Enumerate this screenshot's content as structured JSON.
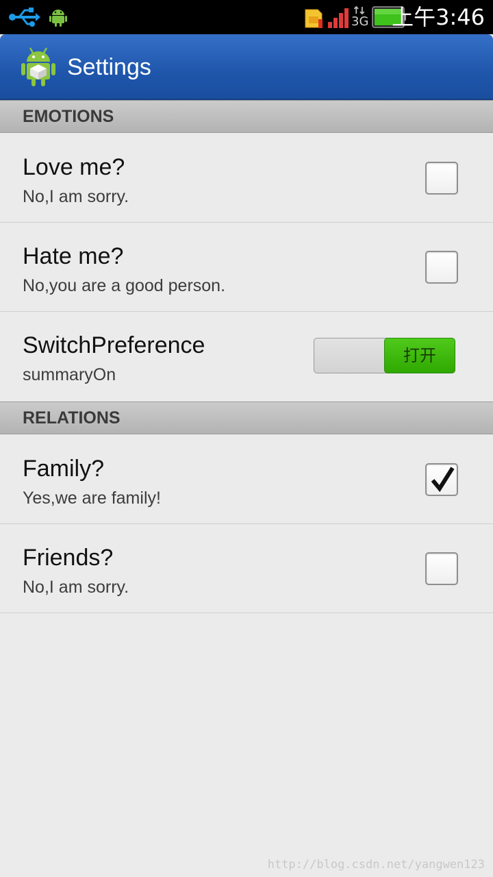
{
  "status_bar": {
    "clock": "上午3:46",
    "icons": [
      "usb-icon",
      "android-debug-icon",
      "sim-icon",
      "signal-icon",
      "data-3g-icon",
      "battery-icon"
    ],
    "network_label": "3G"
  },
  "action_bar": {
    "title": "Settings",
    "icon": "android-app-icon",
    "color": "#2662bc"
  },
  "categories": [
    {
      "title": "EMOTIONS",
      "items": [
        {
          "type": "checkbox",
          "title": "Love me?",
          "summary": "No,I am sorry.",
          "checked": false
        },
        {
          "type": "checkbox",
          "title": "Hate me?",
          "summary": "No,you are a good person.",
          "checked": false
        },
        {
          "type": "switch",
          "title": "SwitchPreference",
          "summary": "summaryOn",
          "on": true,
          "switch_label": "打开",
          "accent": "#3cb80a"
        }
      ]
    },
    {
      "title": "RELATIONS",
      "items": [
        {
          "type": "checkbox",
          "title": "Family?",
          "summary": "Yes,we are family!",
          "checked": true
        },
        {
          "type": "checkbox",
          "title": "Friends?",
          "summary": "No,I am sorry.",
          "checked": false
        }
      ]
    }
  ],
  "watermark": "http://blog.csdn.net/yangwen123"
}
